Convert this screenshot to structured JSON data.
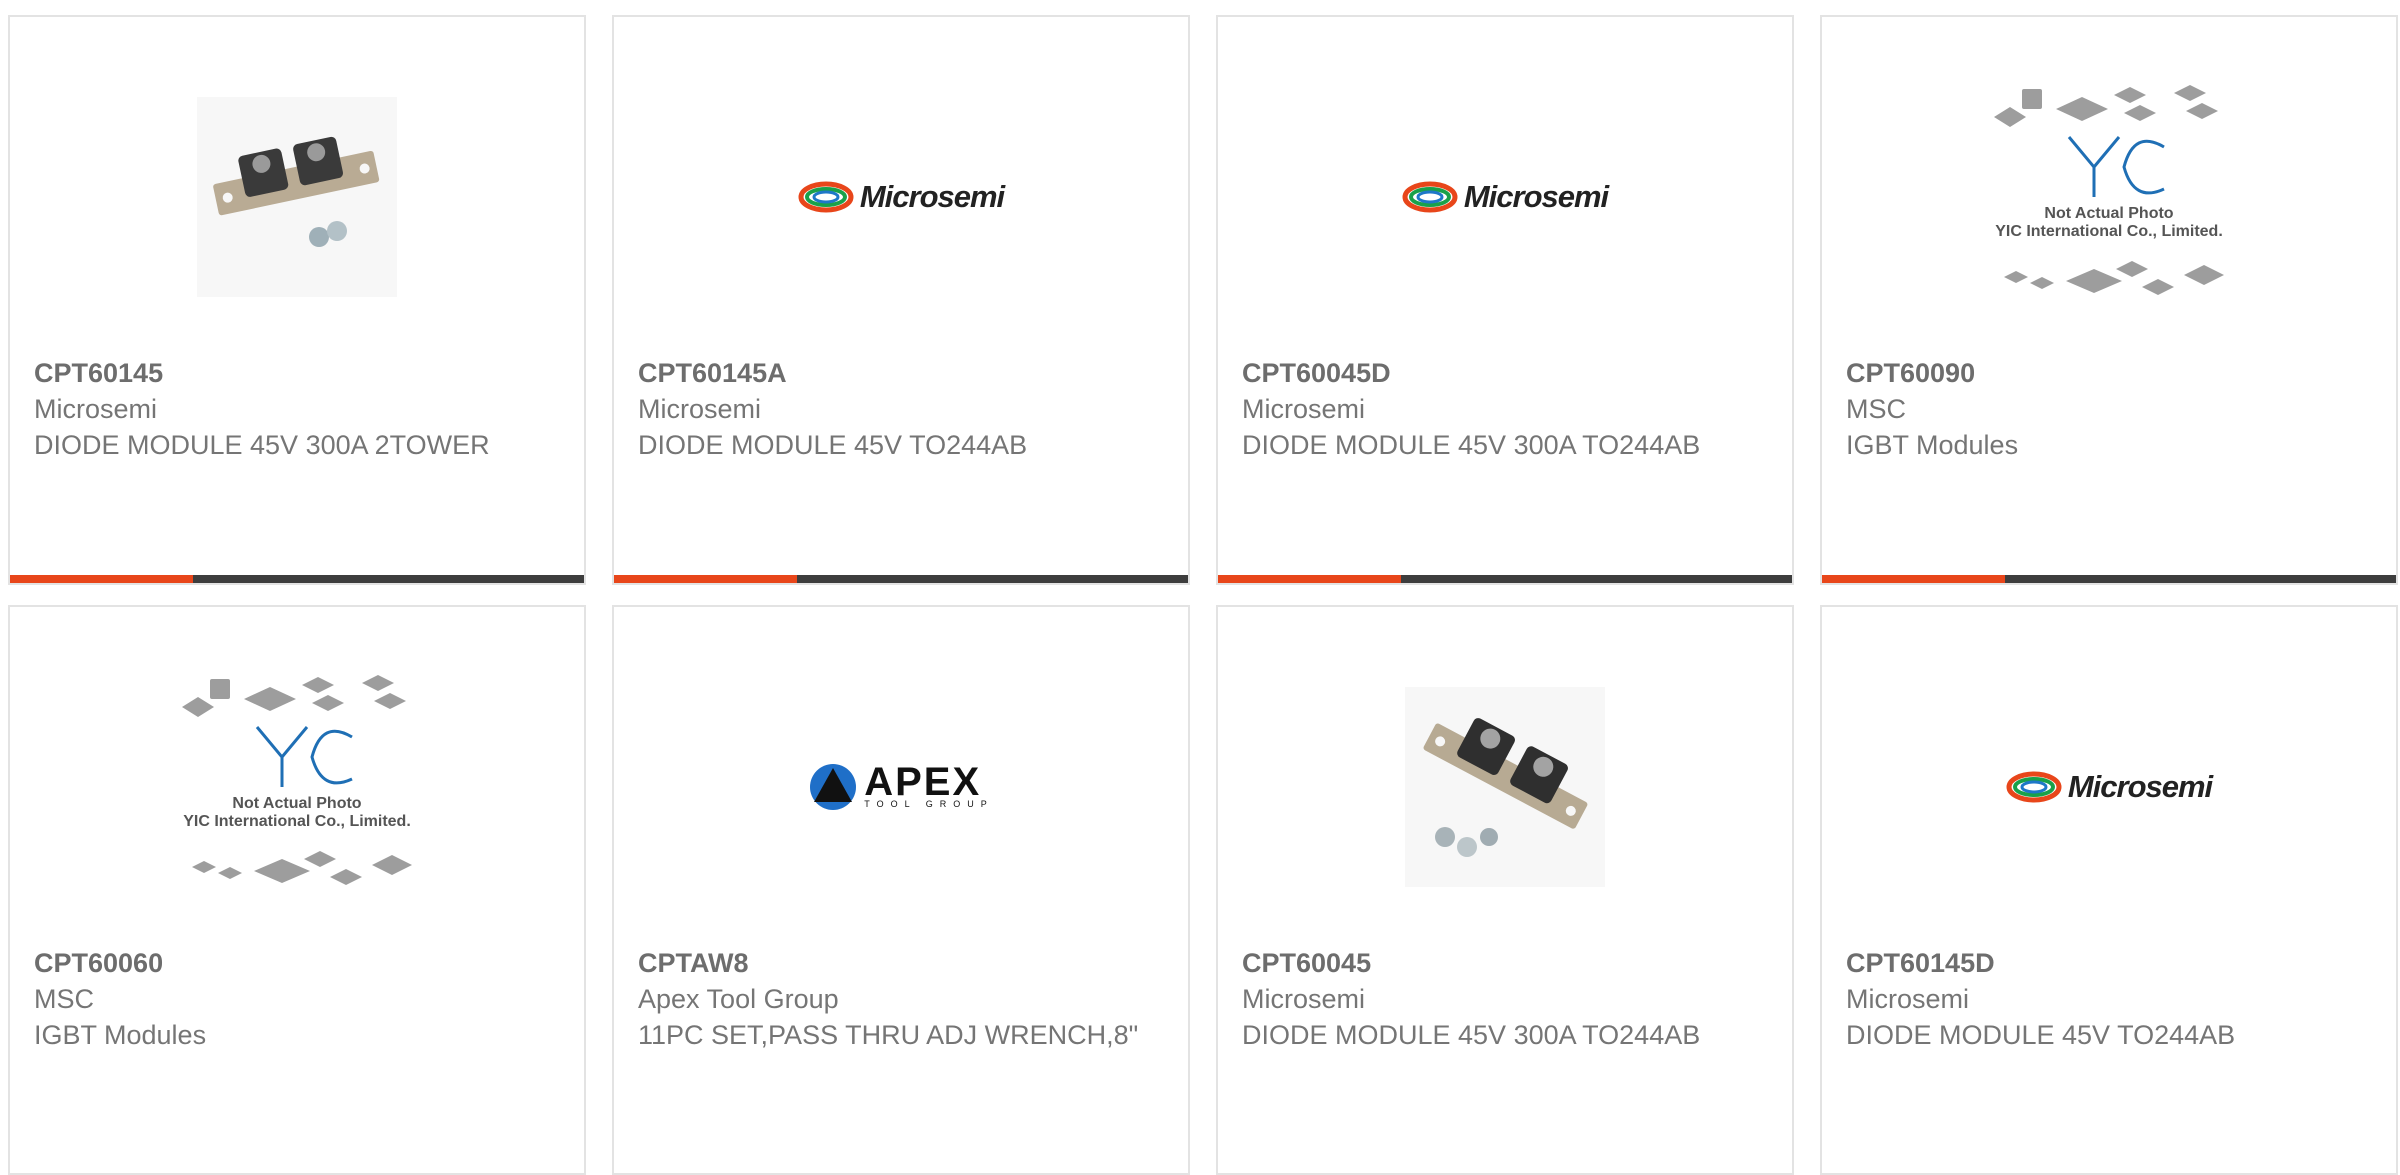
{
  "products": [
    {
      "part_number": "CPT60145",
      "manufacturer": "Microsemi",
      "description": "DIODE MODULE 45V 300A 2TOWER",
      "image": "diode-module-photo"
    },
    {
      "part_number": "CPT60145A",
      "manufacturer": "Microsemi",
      "description": "DIODE MODULE 45V TO244AB",
      "image": "microsemi-logo"
    },
    {
      "part_number": "CPT60045D",
      "manufacturer": "Microsemi",
      "description": "DIODE MODULE 45V 300A TO244AB",
      "image": "microsemi-logo"
    },
    {
      "part_number": "CPT60090",
      "manufacturer": "MSC",
      "description": "IGBT Modules",
      "image": "yic-placeholder"
    },
    {
      "part_number": "CPT60060",
      "manufacturer": "MSC",
      "description": "IGBT Modules",
      "image": "yic-placeholder"
    },
    {
      "part_number": "CPTAW8",
      "manufacturer": "Apex Tool Group",
      "description": "11PC SET,PASS THRU ADJ WRENCH,8\"",
      "image": "apex-logo"
    },
    {
      "part_number": "CPT60045",
      "manufacturer": "Microsemi",
      "description": "DIODE MODULE 45V 300A TO244AB",
      "image": "diode-module-photo"
    },
    {
      "part_number": "CPT60145D",
      "manufacturer": "Microsemi",
      "description": "DIODE MODULE 45V TO244AB",
      "image": "microsemi-logo"
    }
  ],
  "logos": {
    "microsemi_text": "Microsemi",
    "apex_text": "APEX",
    "apex_subtext": "TOOL GROUP",
    "yic_line1": "Not Actual Photo",
    "yic_line2": "YIC International Co., Limited."
  },
  "colors": {
    "accent": "#e8461a",
    "bar": "#3d3d3d",
    "text": "#757575",
    "border": "#e3e3e3"
  }
}
